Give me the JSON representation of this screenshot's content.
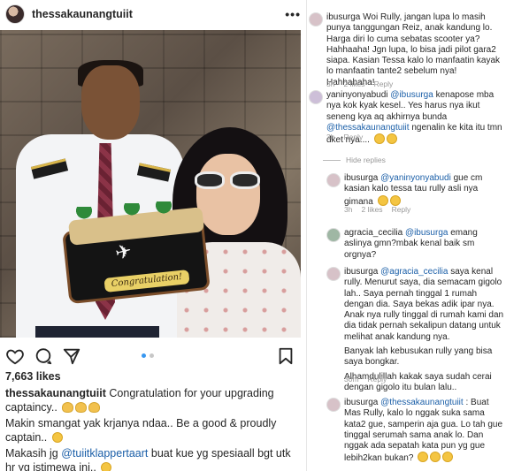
{
  "post": {
    "username": "thessakaunangtuiit",
    "more_glyph": "•••",
    "cake_label": "Congratulation!",
    "likes": "7,663 likes",
    "caption_lines": [
      {
        "user": "thessakaunangtuiit",
        "text": "Congratulation for your upgrading captaincy.."
      },
      {
        "text": "Makin smangat yak krjanya ndaa.. Be a good & proudly captain.."
      },
      {
        "pre": "Makasih jg ",
        "mention": "@tuiitklappertaart",
        "text": " buat kue yg spesiaall bgt utk hr yg istimewa ini.."
      }
    ]
  },
  "icons": {
    "like": "heart-icon",
    "comment": "comment-icon",
    "share": "share-icon",
    "save": "bookmark-icon"
  },
  "comments": [
    {
      "user": "ibusurga",
      "text": "Woi Rully, jangan lupa lo masih punya tanggungan Reiz, anak kandung lo. Harga diri lo cuma sebatas scooter ya? Hahhaaha! Jgn lupa, lo bisa jadi pilot gara2 siapa. Kasian Tessa kalo lo manfaatin kayak lo manfaatin tante2 sebelum nya! Hahhahaha!",
      "time": "3h",
      "likes": "2 likes",
      "reply": "Reply"
    },
    {
      "user": "yaninyonyabudi",
      "mention": "@ibusurga",
      "text": " kenapose mba nya kok kyak kesel.. Yes harus nya ikut seneng kya aq akhirnya bunda ",
      "mention2": "@thessakaunangtuiit",
      "text2": " ngenalin ke kita itu tmn dket nya....",
      "time": "3h",
      "reply": "Reply"
    },
    {
      "hide": "Hide replies"
    },
    {
      "user": "ibusurga",
      "mention": "@yaninyonyabudi",
      "text": " gue cm kasian kalo tessa tau rully asli nya gimana",
      "time": "3h",
      "likes": "2 likes",
      "reply": "Reply"
    },
    {
      "user": "agracia_cecilia",
      "mention": "@ibusurga",
      "text": " emang aslinya gmn?mbak kenal baik sm orgnya?",
      "time": "",
      "reply": ""
    },
    {
      "user": "ibusurga",
      "mention": "@agracia_cecilia",
      "text": " saya kenal rully. Menurut saya, dia semacam gigolo lah.. Saya pernah tinggal 1 rumah dengan dia. Saya bekas adik ipar nya. Anak nya rully tinggal di rumah kami dan dia tidak pernah sekalipun datang untuk melihat anak kandung nya.",
      "para2": "Banyak lah kebusukan rully yang bisa saya bongkar.",
      "para3": "Alhamdulillah kakak saya sudah cerai dengan gigolo itu bulan lalu..",
      "time": "30m",
      "reply": "Reply"
    },
    {
      "user": "ibusurga",
      "mention": "@thessakaunangtuiit",
      "text": " : Buat Mas Rully, kalo lo nggak suka sama kata2 gue, samperin aja gua. Lo tah gue tinggal serumah sama anak lo. Dan nggak ada sepatah kata pun yg gue lebih2kan bukan?",
      "time": "",
      "reply": ""
    }
  ],
  "colors": {
    "text": "#262626",
    "muted": "#999999",
    "mention": "#1b5fa8",
    "carousel_active": "#3897f0"
  }
}
